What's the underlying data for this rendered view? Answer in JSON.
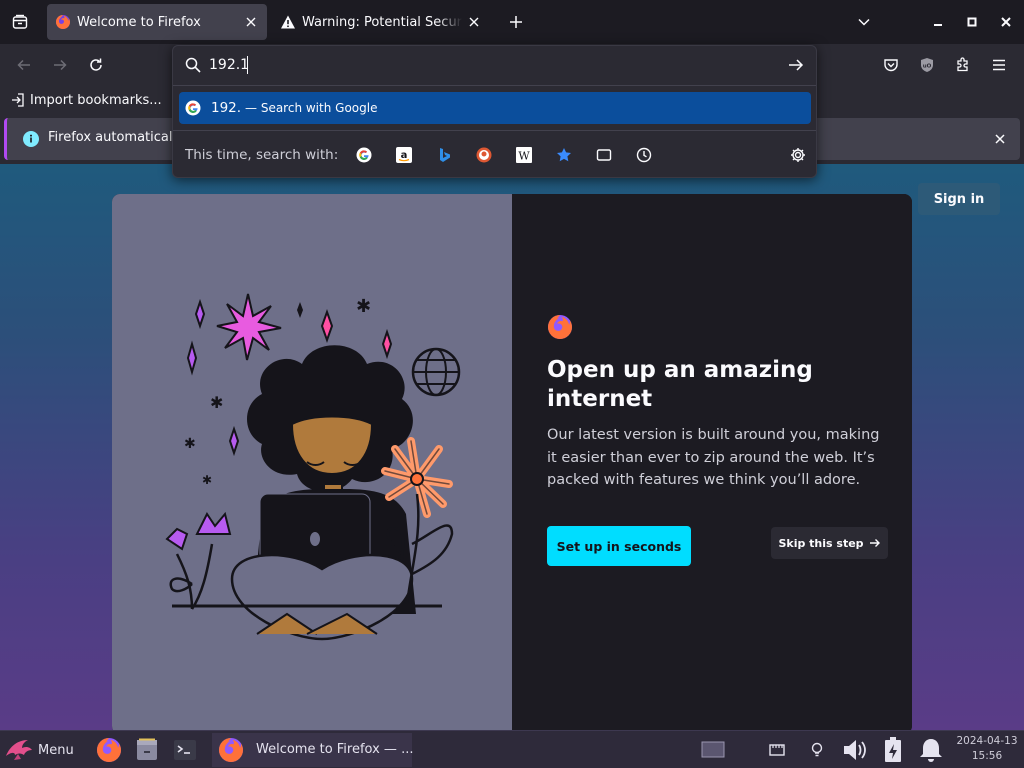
{
  "window": {
    "tabs": [
      {
        "title": "Welcome to Firefox",
        "active": true,
        "favicon": "firefox-icon"
      },
      {
        "title": "Warning: Potential Security Risk Ahead",
        "active": false,
        "favicon": "warning-icon"
      }
    ]
  },
  "urlbar": {
    "value": "192.1",
    "suggestion": {
      "text": "192.",
      "separator": "—",
      "action": "Search with Google",
      "icon": "google-icon"
    },
    "oneoff_label": "This time, search with:",
    "engines": [
      "google-icon",
      "amazon-icon",
      "bing-icon",
      "duckduckgo-icon",
      "wikipedia-icon",
      "bookmarks-star-icon",
      "tabs-icon",
      "history-icon"
    ]
  },
  "bookmarks": {
    "import_label": "Import bookmarks..."
  },
  "notification": {
    "text": "Firefox automatically"
  },
  "page": {
    "signin_label": "Sign in",
    "title": "Open up an amazing internet",
    "body": "Our latest version is built around you, making it easier than ever to zip around the web. It’s packed with features we think you’ll adore.",
    "setup_label": "Set up in seconds",
    "skip_label": "Skip this step"
  },
  "taskbar": {
    "menu_label": "Menu",
    "task_title": "Welcome to Firefox — ...",
    "clock_date": "2024-04-13",
    "clock_time": "15:56"
  },
  "colors": {
    "accent": "#00ddff",
    "highlight": "#0b4e9c",
    "panel": "#2b2a33",
    "tab_active": "#42414d"
  }
}
